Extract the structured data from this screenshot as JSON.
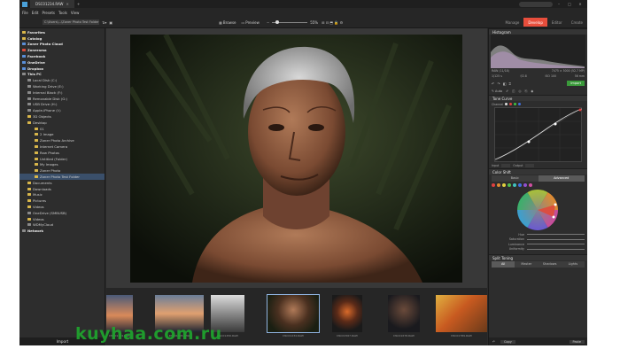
{
  "window": {
    "tab_title": "DSC01234.RAW"
  },
  "menu": [
    "File",
    "Edit",
    "Presets",
    "Tools",
    "View"
  ],
  "toolbar": {
    "path": "C:\\Users\\...\\Zoner Photo Test Folder",
    "browse_label": "Browse",
    "preview_label": "Preview",
    "zoom": "55%"
  },
  "modes": [
    "Manage",
    "Develop",
    "Editor",
    "Create"
  ],
  "navigator": {
    "items": [
      {
        "label": "Favorites",
        "icon": "star-icon",
        "bold": true
      },
      {
        "label": "Catalog",
        "icon": "catalog-icon",
        "bold": true
      },
      {
        "label": "Zoner Photo Cloud",
        "icon": "cloud-icon",
        "bold": true
      },
      {
        "label": "Zonerama",
        "icon": "zonerama-icon",
        "bold": true
      },
      {
        "label": "Facebook",
        "icon": "facebook-icon",
        "bold": true
      },
      {
        "label": "OneDrive",
        "icon": "onedrive-icon",
        "bold": true
      },
      {
        "label": "Dropbox",
        "icon": "dropbox-icon",
        "bold": true
      },
      {
        "label": "This PC",
        "icon": "pc-icon",
        "bold": true
      },
      {
        "label": "Local Disk (C:)",
        "icon": "drive-icon"
      },
      {
        "label": "Working Drive (E:)",
        "icon": "drive-icon"
      },
      {
        "label": "Internal Black (F:)",
        "icon": "drive-icon"
      },
      {
        "label": "Removable Disk (G:)",
        "icon": "drive-icon"
      },
      {
        "label": "USB Drive (H:)",
        "icon": "drive-icon"
      },
      {
        "label": "Apple-iPhone (I:)",
        "icon": "drive-icon"
      },
      {
        "label": "3D Objects",
        "icon": "folder-icon"
      },
      {
        "label": "Desktop",
        "icon": "folder-icon"
      },
      {
        "label": "01",
        "icon": "folder-icon"
      },
      {
        "label": "2 Image",
        "icon": "folder-icon"
      },
      {
        "label": "Zoner Photo Archive",
        "icon": "folder-icon"
      },
      {
        "label": "Internet Camera",
        "icon": "folder-icon"
      },
      {
        "label": "Raw Photos",
        "icon": "folder-icon"
      },
      {
        "label": "Untitled (Folder)",
        "icon": "folder-icon"
      },
      {
        "label": "My Images",
        "icon": "folder-icon"
      },
      {
        "label": "Zoner Photo",
        "icon": "folder-icon"
      },
      {
        "label": "Zoner Photo Test Folder",
        "icon": "folder-icon",
        "selected": true
      },
      {
        "label": "Documents",
        "icon": "folder-icon"
      },
      {
        "label": "Downloads",
        "icon": "folder-icon"
      },
      {
        "label": "Music",
        "icon": "folder-icon"
      },
      {
        "label": "Pictures",
        "icon": "folder-icon"
      },
      {
        "label": "Videos",
        "icon": "folder-icon"
      },
      {
        "label": "OneDrive (SMBUSB)",
        "icon": "drive-icon"
      },
      {
        "label": "Videos",
        "icon": "folder-icon"
      },
      {
        "label": "WDMyCloud",
        "icon": "drive-icon"
      },
      {
        "label": "Network",
        "icon": "network-icon",
        "bold": true
      }
    ]
  },
  "import_label": "Import",
  "filmstrip": [
    {
      "caption": "DSC01234.RAW",
      "palette": "sunset"
    },
    {
      "caption": "DSC01345.RAW",
      "palette": "lake"
    },
    {
      "caption": "DSC01456.RAW",
      "palette": "bw"
    },
    {
      "caption": "DSC01234.RAW",
      "palette": "portrait"
    },
    {
      "caption": "DSC01567.RAW",
      "palette": "orange"
    },
    {
      "caption": "DSC01678.RAW",
      "palette": "dark"
    },
    {
      "caption": "DSC01789.RAW",
      "palette": "autumn"
    }
  ],
  "right_panel": {
    "histogram_title": "Histogram",
    "info_left": "RAW  (11/18)",
    "info_right": "7475 × 5000 (52.7 MP)",
    "exif": [
      "1/125 s",
      "f/2.8",
      "ISO 100",
      "56 mm"
    ],
    "import_btn": "Import",
    "tone_curve_title": "Tone Curve",
    "channel_label": "Channel",
    "input_label": "Input",
    "output_label": "Output",
    "color_shift_title": "Color Shift",
    "color_shift_tabs": [
      "Basic",
      "Advanced"
    ],
    "hue_label": "Hue",
    "saturation_label": "Saturation",
    "luminance_label": "Luminance",
    "uniformity_label": "Uniformity",
    "split_toning_title": "Split Toning",
    "split_tabs": [
      "All",
      "Master",
      "Shadows",
      "Lights"
    ],
    "copy_label": "Copy",
    "paste_label": "Paste"
  },
  "watermark": "kuyhaa.com.ru"
}
